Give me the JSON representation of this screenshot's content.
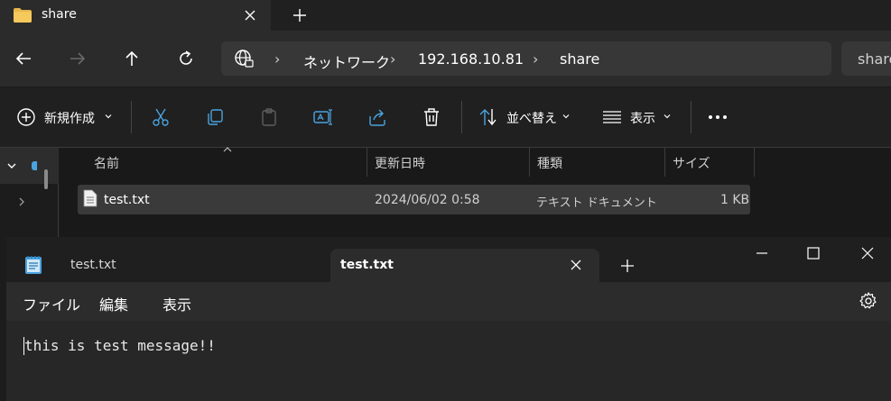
{
  "explorer": {
    "tab_title": "share",
    "breadcrumb": [
      "ネットワーク",
      "192.168.10.81",
      "share"
    ],
    "search_text": "share",
    "toolbar": {
      "new_label": "新規作成",
      "sort_label": "並べ替え",
      "view_label": "表示"
    },
    "columns": [
      "名前",
      "更新日時",
      "種類",
      "サイズ"
    ],
    "files": [
      {
        "name": "test.txt",
        "modified": "2024/06/02 0:58",
        "type": "テキスト ドキュメント",
        "size": "1 KB"
      }
    ]
  },
  "notepad": {
    "tabs": [
      "test.txt",
      "test.txt"
    ],
    "menu": [
      "ファイル",
      "編集",
      "表示"
    ],
    "content": "this is test message!!"
  },
  "colors": {
    "folder": "#e8b84a",
    "notepad_icon": "#4aa3e0",
    "selection": "#3a3a3a"
  }
}
